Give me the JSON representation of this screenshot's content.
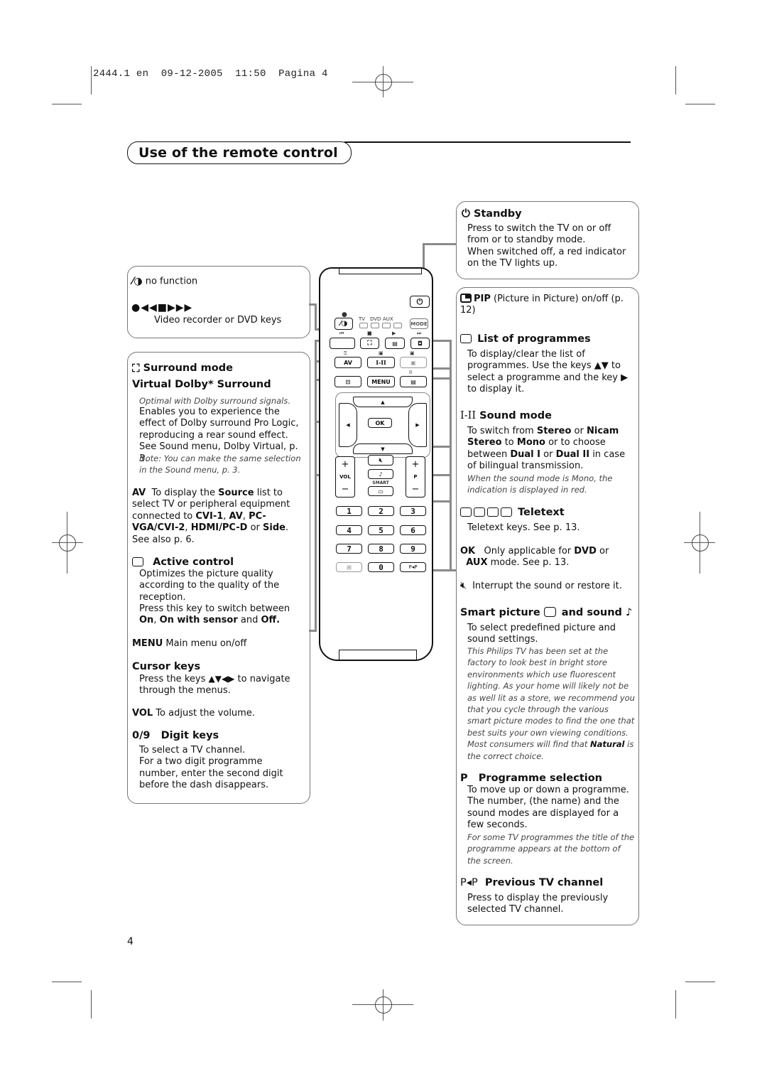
{
  "print_header": {
    "job": "2444.1 en",
    "date": "09-12-2005",
    "time": "11:50",
    "page_label": "Pagina 4"
  },
  "page_title": "Use of the remote control",
  "page_number": "4",
  "left_top_box": {
    "no_function_label": "no function",
    "transport_keys_desc": "Video recorder or DVD keys"
  },
  "surround": {
    "title": "Surround mode",
    "subtitle": "Virtual Dolby* Surround",
    "note1": "Optimal with Dolby surround signals.",
    "desc": "Enables you to experience the effect of Dolby surround Pro Logic, reproducing a rear sound effect. See Sound menu, Dolby Virtual, p. 3.",
    "note2": "Note: You can make the same selection in the Sound menu, p. 3."
  },
  "av": {
    "key": "AV",
    "desc_pre": "To display the ",
    "source": "Source",
    "desc_mid": " list to select TV or peripheral equipment connected to ",
    "cvi1": "CVI-1",
    "sep1": ", ",
    "av": "AV",
    "sep2": ", ",
    "pcvga": "PC-VGA/CVI-2",
    "sep3": ",  ",
    "hdmi": "HDMI/PC-D",
    "or": " or ",
    "side": "Side",
    "end": ". See also p. 6."
  },
  "active_control": {
    "title": "Active control",
    "desc1": "Optimizes the picture quality according to the quality of the reception.",
    "desc2": "Press this key to switch between",
    "opt_on": "On",
    "opt_sensor": "On with sensor",
    "and": " and ",
    "opt_off": "Off."
  },
  "menu": {
    "key": "MENU",
    "desc": "Main menu on/off"
  },
  "cursor": {
    "title": "Cursor keys",
    "desc_pre": "Press the keys",
    "arrows": "▲▼◀▶",
    "desc_post": "to navigate through the menus."
  },
  "vol": {
    "key": "VOL",
    "desc": "To adjust the volume."
  },
  "digits": {
    "key": "0/9",
    "title": "Digit keys",
    "desc1": "To select a TV channel.",
    "desc2": "For a two digit programme number, enter the second digit before the dash disappears."
  },
  "standby": {
    "title": "Standby",
    "desc1": "Press to switch the TV on or off from or to standby mode.",
    "desc2": "When switched off, a red indicator on the TV lights up."
  },
  "pip": {
    "key": "PIP",
    "desc": "(Picture in Picture) on/off (p. 12)"
  },
  "list_programmes": {
    "title": "List of programmes",
    "desc": "To display/clear the list of programmes. Use the keys ▲▼ to select a programme and the key ▶ to display it."
  },
  "sound_mode": {
    "key": "I-II",
    "title": "Sound mode",
    "p1": "To switch from ",
    "stereo": "Stereo",
    "or1": " or ",
    "nicam": "Nicam Stereo",
    "to": " to ",
    "mono": "Mono",
    "p2": " or to choose between ",
    "dual1": "Dual I",
    "or2": " or ",
    "dual2": "Dual II",
    "p3": " in case of bilingual transmission.",
    "note": "When the sound mode is Mono, the indication is displayed in red."
  },
  "teletext": {
    "title": "Teletext",
    "desc": "Teletext keys. See p. 13."
  },
  "ok": {
    "key": "OK",
    "pre": "Only applicable for ",
    "dvd": "DVD",
    "or": " or ",
    "aux": "AUX",
    "post": " mode. See p. 13."
  },
  "mute": {
    "desc": "Interrupt the sound or restore it."
  },
  "smart": {
    "title_a": "Smart picture",
    "title_b": "and sound",
    "desc": "To select predefined picture and sound settings.",
    "note_pre": "This Philips TV has been set at the factory to look best in bright store environments which use fluorescent lighting. As your home will likely not be as well lit as a store, we recommend you that you cycle through the various smart picture modes to find the one that best suits your own viewing conditions. Most consumers will find that ",
    "note_bold": "Natural",
    "note_post": " is the correct choice."
  },
  "programme_sel": {
    "key": "P",
    "title": "Programme selection",
    "desc": "To move up or down a programme. The number, (the name) and the sound modes are displayed for a few seconds.",
    "note": "For some TV programmes the title of the programme appears at the bottom of the screen."
  },
  "previous": {
    "key": "P◂P",
    "title": "Previous TV channel",
    "desc": "Press to display the previously selected TV channel."
  },
  "remote": {
    "mode_labels": [
      "TV",
      "DVD",
      "AUX"
    ],
    "mode_key": "MODE",
    "av_key": "AV",
    "sound_key": "I-II",
    "menu_key": "MENU",
    "ok_key": "OK",
    "vol_label": "VOL",
    "p_label": "P",
    "smart_label": "SMART",
    "plus": "+",
    "minus": "−",
    "digits": [
      "1",
      "2",
      "3",
      "4",
      "5",
      "6",
      "7",
      "8",
      "9",
      "0"
    ],
    "pp_key": "P◂P",
    "transport_icons": [
      "⏮",
      "■",
      "▶",
      "⏭"
    ]
  }
}
